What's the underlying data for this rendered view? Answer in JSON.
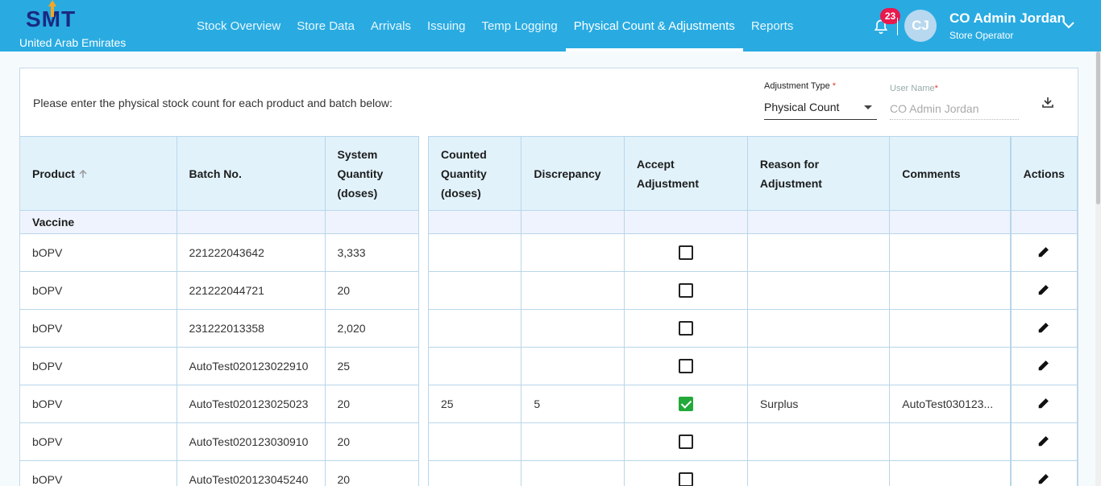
{
  "brand": {
    "logo": "SMT",
    "country": "United Arab Emirates"
  },
  "nav": [
    "Stock Overview",
    "Store Data",
    "Arrivals",
    "Issuing",
    "Temp Logging",
    "Physical Count & Adjustments",
    "Reports"
  ],
  "active_nav": "Physical Count & Adjustments",
  "user": {
    "notifications": "23",
    "initials": "CJ",
    "name": "CO Admin Jordan",
    "role": "Store Operator"
  },
  "form": {
    "instructions": "Please enter the physical stock count for each product and batch below:",
    "adjustment_type_label": "Adjustment Type",
    "adjustment_type_value": "Physical Count",
    "user_name_label": "User Name",
    "user_name_value": "CO Admin Jordan",
    "required_mark": "*"
  },
  "table": {
    "headers": {
      "product": "Product",
      "batch": "Batch No.",
      "system_qty": [
        "System",
        "Quantity",
        "(doses)"
      ],
      "counted_qty": [
        "Counted",
        "Quantity",
        "(doses)"
      ],
      "discrepancy": "Discrepancy",
      "accept": "Accept Adjustment",
      "reason": "Reason for Adjustment",
      "comments": "Comments",
      "actions": "Actions"
    },
    "group": "Vaccine",
    "rows": [
      {
        "product": "bOPV",
        "batch": "221222043642",
        "system_qty": "3,333",
        "counted": "",
        "discrepancy": "",
        "accepted": false,
        "reason": "",
        "comments": ""
      },
      {
        "product": "bOPV",
        "batch": "221222044721",
        "system_qty": "20",
        "counted": "",
        "discrepancy": "",
        "accepted": false,
        "reason": "",
        "comments": ""
      },
      {
        "product": "bOPV",
        "batch": "231222013358",
        "system_qty": "2,020",
        "counted": "",
        "discrepancy": "",
        "accepted": false,
        "reason": "",
        "comments": ""
      },
      {
        "product": "bOPV",
        "batch": "AutoTest020123022910",
        "system_qty": "25",
        "counted": "",
        "discrepancy": "",
        "accepted": false,
        "reason": "",
        "comments": ""
      },
      {
        "product": "bOPV",
        "batch": "AutoTest020123025023",
        "system_qty": "20",
        "counted": "25",
        "discrepancy": "5",
        "accepted": true,
        "reason": "Surplus",
        "comments": "AutoTest030123..."
      },
      {
        "product": "bOPV",
        "batch": "AutoTest020123030910",
        "system_qty": "20",
        "counted": "",
        "discrepancy": "",
        "accepted": false,
        "reason": "",
        "comments": ""
      },
      {
        "product": "bOPV",
        "batch": "AutoTest020123045240",
        "system_qty": "20",
        "counted": "",
        "discrepancy": "",
        "accepted": false,
        "reason": "",
        "comments": ""
      }
    ]
  },
  "colors": {
    "header_bg": "#29abe2",
    "logo": "#1a2a80",
    "badge": "#e8194d",
    "check_green": "#23a93a",
    "table_header_bg": "#e1f2fb"
  }
}
